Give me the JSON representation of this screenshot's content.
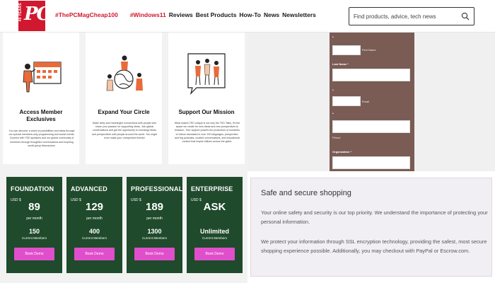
{
  "header": {
    "logo": {
      "years_text": "40 YEARS",
      "mark": "PC"
    },
    "nav": [
      {
        "label": "#ThePCMagCheap100",
        "highlight": true
      },
      {
        "label": "#Windows11",
        "highlight": true
      },
      {
        "label": "Reviews",
        "highlight": false
      },
      {
        "label": "Best Products",
        "highlight": false
      },
      {
        "label": "How-To",
        "highlight": false
      },
      {
        "label": "News",
        "highlight": false
      },
      {
        "label": "Newsletters",
        "highlight": false
      }
    ],
    "search": {
      "placeholder": "Find products, advice, tech news"
    }
  },
  "features": [
    {
      "title_line1": "Access Member",
      "title_line2": "Exclusives",
      "description": "You can discover a world of possibilities and ideas through our special members-only programming and social events. Connect with TED speakers and our global community of members through thoughtful conversations and inspiring small group discussions."
    },
    {
      "title_line1": "Expand Your Circle",
      "title_line2": "",
      "description": "Make deep and meaningful connections with people who share your passion for supporting ideas. Join global conversations and get the opportunity to exchange ideas and perspectives with people around the world. You might even make your unexpected friends!"
    },
    {
      "title_line1": "Support Our Mission",
      "title_line2": "",
      "description": "What makes TED unique is not only the TED Talks, it's the space we create for new ideas and new perspectives to blossom. Your support powers the production of hundreds of videos translated in over 100 languages, perspective- and big podcasts, curated conversations, and educational content that inspire billions across the globe."
    }
  ],
  "form": {
    "first_name_label": "First Name",
    "last_name_label": "Last Name *",
    "email_label": "Email",
    "phone_label": "Phone",
    "organization_label": "Organization *",
    "bullet": "•"
  },
  "plans": [
    {
      "name": "FOUNDATION",
      "currency": "USD $",
      "price": "89",
      "period": "per month",
      "members": "150",
      "members_label": "Current Members",
      "button": "Book Demo"
    },
    {
      "name": "ADVANCED",
      "currency": "USD $",
      "price": "129",
      "period": "per month",
      "members": "400",
      "members_label": "Current Members",
      "button": "Book Demo"
    },
    {
      "name": "PROFESSIONAL",
      "currency": "USD $",
      "price": "189",
      "period": "per month",
      "members": "1300",
      "members_label": "Current Members",
      "button": "Book Demo"
    },
    {
      "name": "ENTERPRISE",
      "currency": "USD $",
      "price": "ASK",
      "period": "",
      "members": "Unlimited",
      "members_label": "Current Members",
      "button": "Book Demo"
    }
  ],
  "safe_shopping": {
    "title": "Safe and secure shopping",
    "paragraph1": "Your online safety and security is our top priority. We understand the importance of protecting your personal information.",
    "paragraph2": "We protect your information through SSL encryption technology, providing the safest, most secure shopping experience possible. Additionally, you may checkout with PayPal or Escrow.com."
  },
  "colors": {
    "brand_red": "#d2182f",
    "plan_green": "#1f4a2b",
    "button_pink": "#e04fcb",
    "form_brown": "#7a5c55"
  }
}
